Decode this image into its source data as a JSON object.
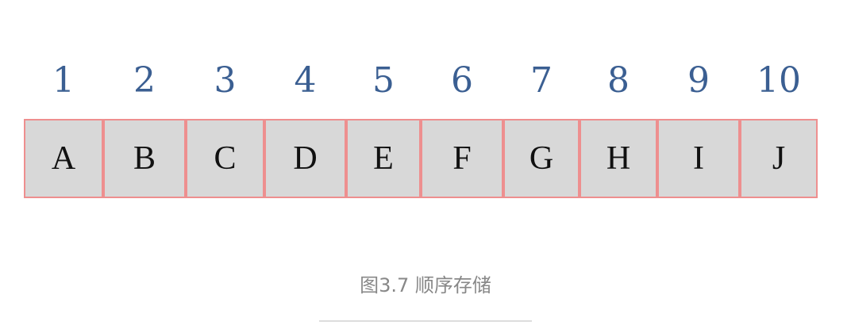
{
  "figure": {
    "indices": [
      "1",
      "2",
      "3",
      "4",
      "5",
      "6",
      "7",
      "8",
      "9",
      "10"
    ],
    "cells": [
      "A",
      "B",
      "C",
      "D",
      "E",
      "F",
      "G",
      "H",
      "I",
      "J"
    ],
    "caption": "图3.7 顺序存储"
  },
  "colors": {
    "index_text": "#3b5f92",
    "cell_fill": "#d8d8d8",
    "cell_border": "#ee8f8f",
    "cell_text": "#111111",
    "caption_text": "#888888"
  }
}
